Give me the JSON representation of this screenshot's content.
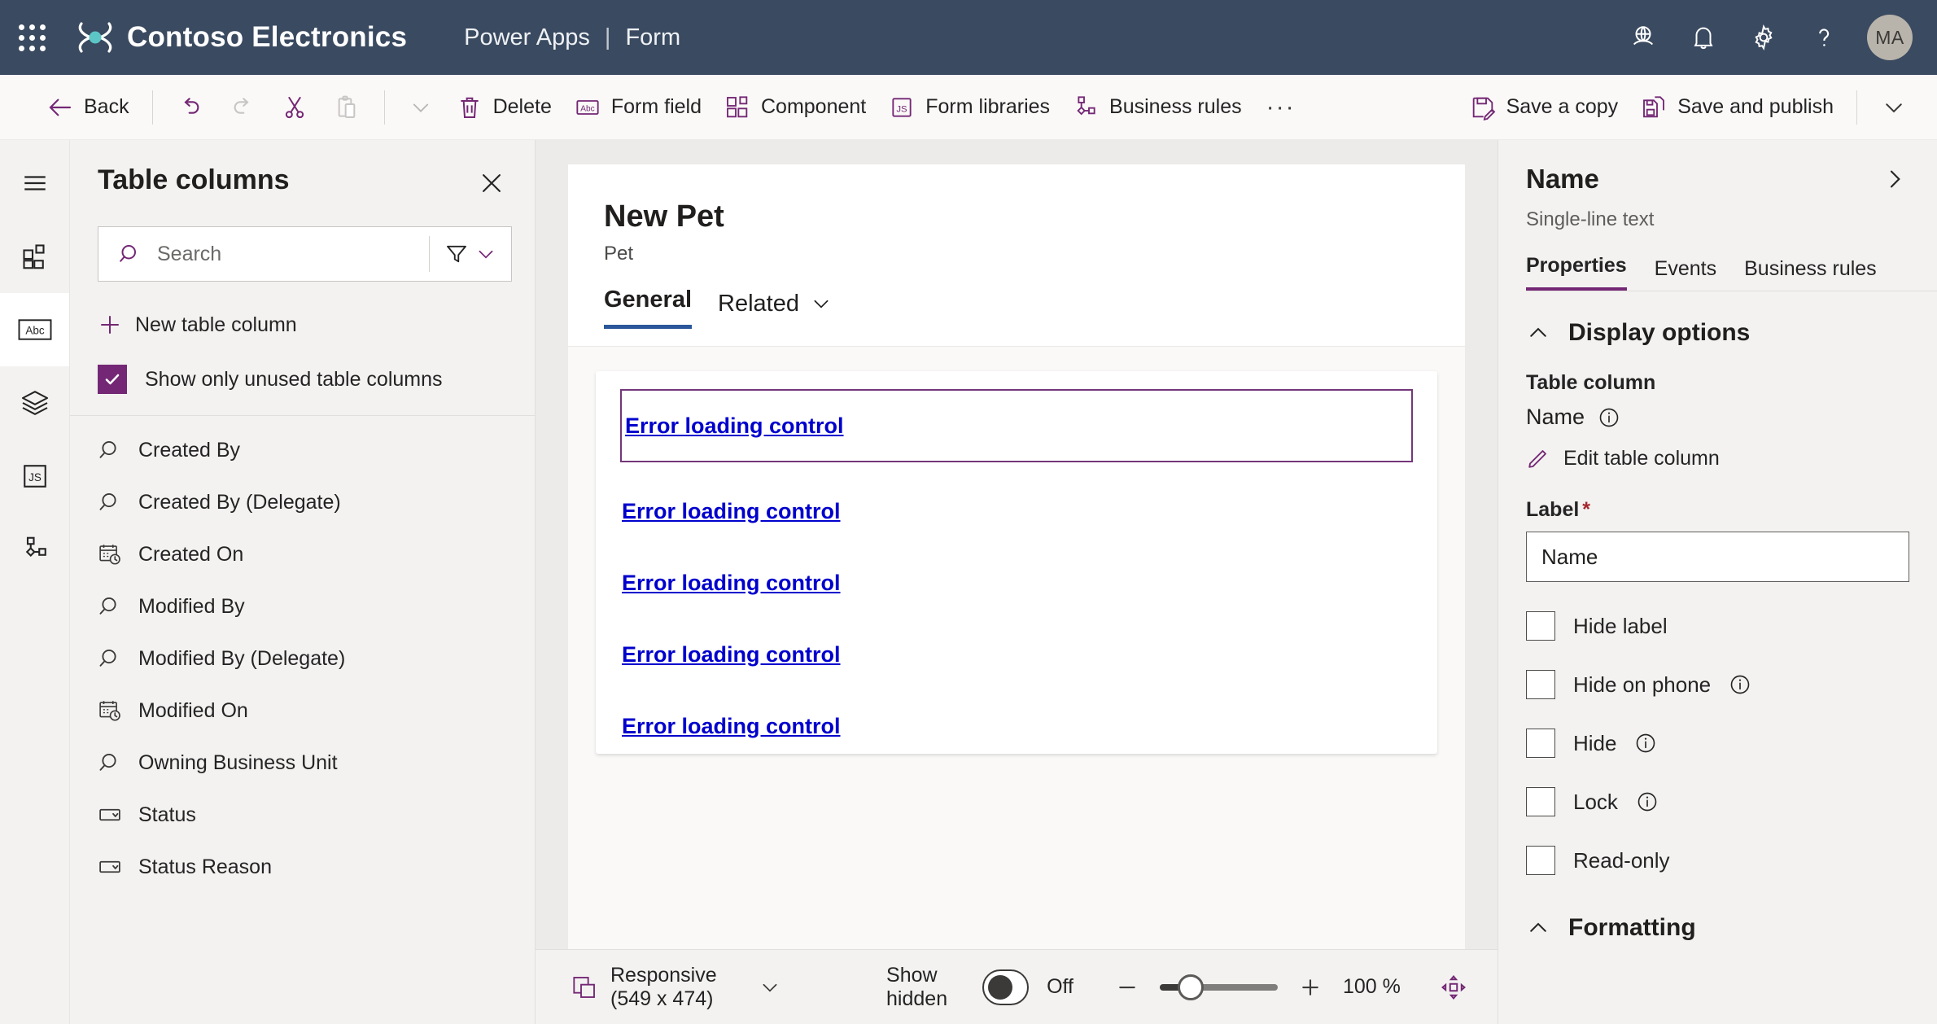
{
  "header": {
    "waffle_label": "app-launcher",
    "brand": "Contoso Electronics",
    "app_name": "Power Apps",
    "separator": "|",
    "page_kind": "Form",
    "icons": [
      {
        "name": "environment-icon",
        "label": "Environment"
      },
      {
        "name": "notifications-icon",
        "label": "Notifications"
      },
      {
        "name": "settings-icon",
        "label": "Settings"
      },
      {
        "name": "help-icon",
        "label": "Help"
      }
    ],
    "avatar_initials": "MA"
  },
  "commandbar": {
    "back": "Back",
    "undo": "Undo",
    "redo": "Redo",
    "cut": "Cut",
    "paste": "Paste",
    "more_clipboard": "More clipboard commands",
    "delete": "Delete",
    "form_field": "Form field",
    "component": "Component",
    "form_libraries": "Form libraries",
    "business_rules": "Business rules",
    "overflow": "···",
    "save_a_copy": "Save a copy",
    "save_and_publish": "Save and publish",
    "save_more": "More save commands"
  },
  "rail": {
    "items": [
      {
        "name": "hamburger-menu-icon",
        "label": "Expand navigation",
        "active": false
      },
      {
        "name": "components-icon",
        "label": "Components",
        "active": false
      },
      {
        "name": "table-columns-icon",
        "label": "Table columns",
        "active": true
      },
      {
        "name": "layers-icon",
        "label": "Tree view",
        "active": false
      },
      {
        "name": "javascript-icon",
        "label": "Form libraries",
        "active": false
      },
      {
        "name": "business-rules-icon",
        "label": "Business rules",
        "active": false
      }
    ]
  },
  "table_columns_panel": {
    "title": "Table columns",
    "close_label": "Close",
    "search_placeholder": "Search",
    "search_value": "",
    "filter_label": "Filter",
    "new_column": "New table column",
    "show_unused_label": "Show only unused table columns",
    "show_unused_checked": true,
    "columns": [
      {
        "label": "Created By",
        "icon": "lookup-icon"
      },
      {
        "label": "Created By (Delegate)",
        "icon": "lookup-icon"
      },
      {
        "label": "Created On",
        "icon": "datetime-icon"
      },
      {
        "label": "Modified By",
        "icon": "lookup-icon"
      },
      {
        "label": "Modified By (Delegate)",
        "icon": "lookup-icon"
      },
      {
        "label": "Modified On",
        "icon": "datetime-icon"
      },
      {
        "label": "Owning Business Unit",
        "icon": "lookup-icon"
      },
      {
        "label": "Status",
        "icon": "choice-icon"
      },
      {
        "label": "Status Reason",
        "icon": "choice-icon"
      }
    ]
  },
  "canvas": {
    "form_title": "New Pet",
    "form_subtitle": "Pet",
    "tabs": [
      {
        "label": "General",
        "active": true,
        "has_chevron": false
      },
      {
        "label": "Related",
        "active": false,
        "has_chevron": true
      }
    ],
    "controls": [
      {
        "label": "Error loading control",
        "selected": true
      },
      {
        "label": "Error loading control",
        "selected": false
      },
      {
        "label": "Error loading control",
        "selected": false
      },
      {
        "label": "Error loading control",
        "selected": false
      },
      {
        "label": "Error loading control",
        "selected": false
      }
    ]
  },
  "statusbar": {
    "form_factor": "Responsive (549 x 474)",
    "show_hidden_label": "Show hidden",
    "show_hidden_state": "Off",
    "zoom_out_label": "Zoom out",
    "zoom_in_label": "Zoom in",
    "zoom_value": "100 %",
    "fit_label": "Fit to screen"
  },
  "properties": {
    "title": "Name",
    "subtitle": "Single-line text",
    "expand_label": "Expand panel",
    "tabs": [
      {
        "label": "Properties",
        "active": true
      },
      {
        "label": "Events",
        "active": false
      },
      {
        "label": "Business rules",
        "active": false
      }
    ],
    "display_options": {
      "section_title": "Display options",
      "table_column_label": "Table column",
      "table_column_value": "Name",
      "edit_table_column": "Edit table column",
      "label_field_label": "Label",
      "label_field_required": "*",
      "label_field_value": "Name",
      "checkboxes": [
        {
          "label": "Hide label",
          "checked": false,
          "info": false
        },
        {
          "label": "Hide on phone",
          "checked": false,
          "info": true
        },
        {
          "label": "Hide",
          "checked": false,
          "info": true
        },
        {
          "label": "Lock",
          "checked": false,
          "info": true
        },
        {
          "label": "Read-only",
          "checked": false,
          "info": false
        }
      ]
    },
    "formatting": {
      "section_title": "Formatting"
    }
  },
  "colors": {
    "header_bg": "#3a4a60",
    "accent_purple": "#742774",
    "tab_blue": "#2b579a",
    "link_blue": "#0000cd",
    "required_red": "#a4262c",
    "panel_bg": "#f3f2f1",
    "canvas_bg": "#edebe9"
  }
}
